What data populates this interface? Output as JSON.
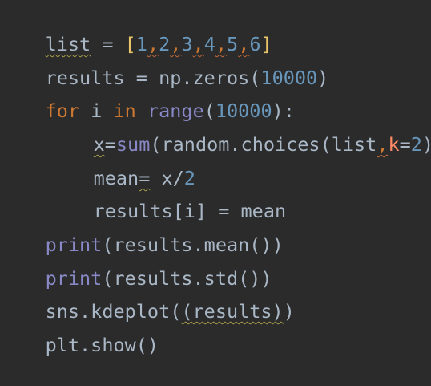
{
  "editor": {
    "theme_colors": {
      "background": "#2b2b2b",
      "identifier": "#a9b7c6",
      "keyword": "#cc7832",
      "builtin": "#8888c6",
      "number": "#6897bb",
      "parameter": "#ff8a66",
      "bracket_highlight": "#e8c46a"
    },
    "lines": {
      "l1": {
        "var": "list",
        "eq": " = ",
        "open": "[",
        "n1": "1",
        "c1": ",",
        "n2": "2",
        "c2": ",",
        "n3": "3",
        "c3": ",",
        "n4": "4",
        "c4": ",",
        "n5": "5",
        "c5": ",",
        "n6": "6",
        "close": "]"
      },
      "l2": {
        "lhs": "results = np.zeros(",
        "num": "10000",
        "rhs": ")"
      },
      "l3": {
        "kw_for": "for",
        "mid": " i ",
        "kw_in": "in",
        "sp": " ",
        "fn_range": "range",
        "open": "(",
        "num": "10000",
        "close": "):"
      },
      "l4": {
        "var": "x",
        "eq": "=",
        "fn_sum": "sum",
        "mid": "(random.choices(list",
        "comma": ",",
        "param": "k",
        "eq2": "=",
        "num": "2",
        "close": "))"
      },
      "l5": {
        "lhs": "mean",
        "eq": "=",
        "rhs": " x/",
        "num": "2"
      },
      "l6": {
        "text": "results[i] = mean"
      },
      "l7": {
        "fn": "print",
        "rest": "(results.mean())"
      },
      "l8": {
        "fn": "print",
        "rest": "(results.std())"
      },
      "l9": {
        "pre": "sns.kdeplot(",
        "wave": "(results)",
        "post": ")"
      },
      "l10": {
        "text": "plt.show()"
      }
    }
  }
}
